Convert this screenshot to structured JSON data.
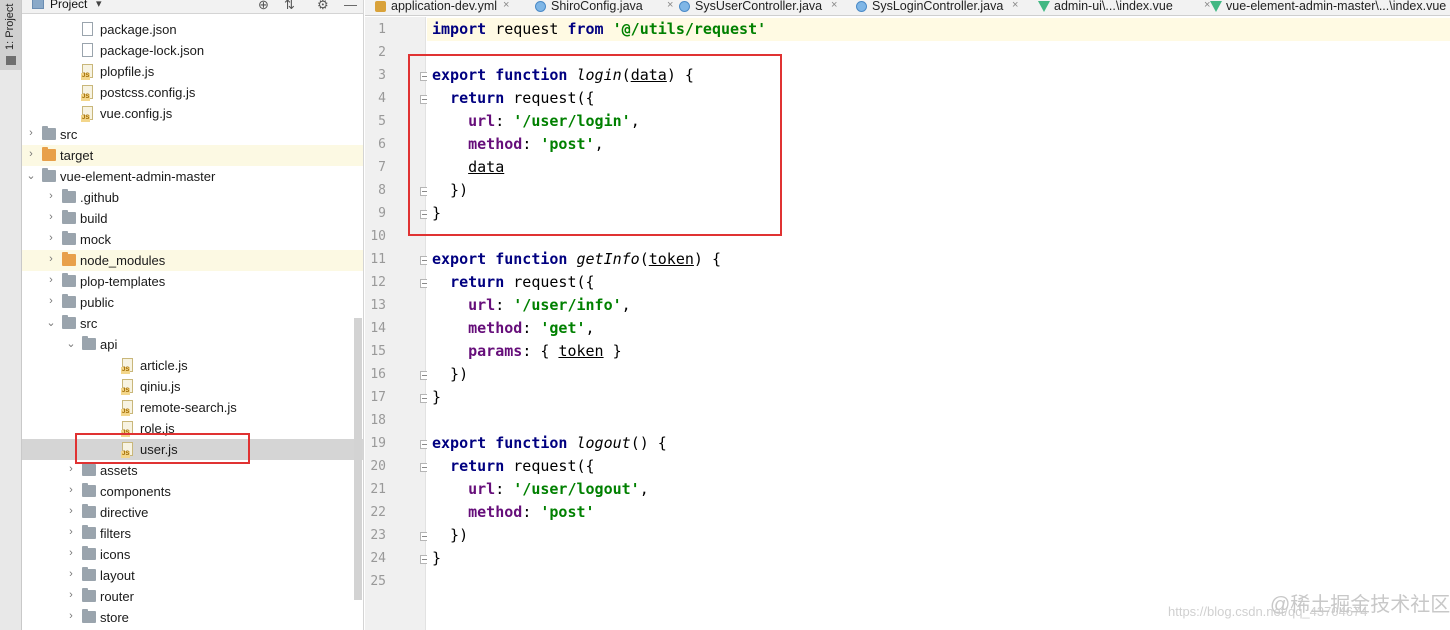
{
  "tool_strip": {
    "label": "1: Project"
  },
  "project_panel": {
    "title": "Project",
    "title_caret": "▾",
    "tools": [
      "⊕",
      "⇅",
      "⚙",
      "—"
    ],
    "tree": [
      {
        "label": "package.json",
        "type": "json",
        "depth": 3,
        "arrow": ""
      },
      {
        "label": "package-lock.json",
        "type": "json",
        "depth": 3,
        "arrow": ""
      },
      {
        "label": "plopfile.js",
        "type": "js",
        "depth": 3,
        "arrow": ""
      },
      {
        "label": "postcss.config.js",
        "type": "js",
        "depth": 3,
        "arrow": ""
      },
      {
        "label": "vue.config.js",
        "type": "js",
        "depth": 3,
        "arrow": ""
      },
      {
        "label": "src",
        "type": "folder",
        "depth": 1,
        "arrow": "›"
      },
      {
        "label": "target",
        "type": "folder-orange",
        "depth": 1,
        "arrow": "›",
        "highlight": "yellow"
      },
      {
        "label": "vue-element-admin-master",
        "type": "folder",
        "depth": 1,
        "arrow": "⌄"
      },
      {
        "label": ".github",
        "type": "folder",
        "depth": 2,
        "arrow": "›"
      },
      {
        "label": "build",
        "type": "folder",
        "depth": 2,
        "arrow": "›"
      },
      {
        "label": "mock",
        "type": "folder",
        "depth": 2,
        "arrow": "›"
      },
      {
        "label": "node_modules",
        "type": "folder-orange",
        "depth": 2,
        "arrow": "›",
        "highlight": "yellow"
      },
      {
        "label": "plop-templates",
        "type": "folder",
        "depth": 2,
        "arrow": "›"
      },
      {
        "label": "public",
        "type": "folder",
        "depth": 2,
        "arrow": "›"
      },
      {
        "label": "src",
        "type": "folder",
        "depth": 2,
        "arrow": "⌄"
      },
      {
        "label": "api",
        "type": "folder",
        "depth": 3,
        "arrow": "⌄"
      },
      {
        "label": "article.js",
        "type": "js",
        "depth": 5,
        "arrow": ""
      },
      {
        "label": "qiniu.js",
        "type": "js",
        "depth": 5,
        "arrow": ""
      },
      {
        "label": "remote-search.js",
        "type": "js",
        "depth": 5,
        "arrow": ""
      },
      {
        "label": "role.js",
        "type": "js",
        "depth": 5,
        "arrow": ""
      },
      {
        "label": "user.js",
        "type": "js",
        "depth": 5,
        "arrow": "",
        "selected": true
      },
      {
        "label": "assets",
        "type": "folder",
        "depth": 3,
        "arrow": "›"
      },
      {
        "label": "components",
        "type": "folder",
        "depth": 3,
        "arrow": "›"
      },
      {
        "label": "directive",
        "type": "folder",
        "depth": 3,
        "arrow": "›"
      },
      {
        "label": "filters",
        "type": "folder",
        "depth": 3,
        "arrow": "›"
      },
      {
        "label": "icons",
        "type": "folder",
        "depth": 3,
        "arrow": "›"
      },
      {
        "label": "layout",
        "type": "folder",
        "depth": 3,
        "arrow": "›"
      },
      {
        "label": "router",
        "type": "folder",
        "depth": 3,
        "arrow": "›"
      },
      {
        "label": "store",
        "type": "folder",
        "depth": 3,
        "arrow": "›"
      }
    ]
  },
  "tabs": [
    {
      "label": "application-dev.yml",
      "icon": "yml",
      "close": "×"
    },
    {
      "label": "ShiroConfig.java",
      "icon": "java",
      "close": "×"
    },
    {
      "label": "SysUserController.java",
      "icon": "java",
      "close": "×"
    },
    {
      "label": "SysLoginController.java",
      "icon": "java",
      "close": "×"
    },
    {
      "label": "admin-ui\\...\\index.vue",
      "icon": "vue",
      "close": "×"
    },
    {
      "label": "vue-element-admin-master\\...\\index.vue",
      "icon": "vue",
      "close": ""
    }
  ],
  "editor": {
    "highlighted_line": 1,
    "lines": [
      {
        "n": "1",
        "tokens": [
          [
            "kw",
            "import"
          ],
          [
            "plain",
            " request "
          ],
          [
            "kw",
            "from"
          ],
          [
            "plain",
            " "
          ],
          [
            "str",
            "'@/utils/request'"
          ]
        ]
      },
      {
        "n": "2",
        "tokens": []
      },
      {
        "n": "3",
        "fold": true,
        "tokens": [
          [
            "kw",
            "export function"
          ],
          [
            "plain",
            " "
          ],
          [
            "fn",
            "login"
          ],
          [
            "plain",
            "("
          ],
          [
            "param",
            "data"
          ],
          [
            "plain",
            ") {"
          ]
        ]
      },
      {
        "n": "4",
        "fold": true,
        "tokens": [
          [
            "plain",
            "  "
          ],
          [
            "kw",
            "return"
          ],
          [
            "plain",
            " request({"
          ]
        ]
      },
      {
        "n": "5",
        "tokens": [
          [
            "plain",
            "    "
          ],
          [
            "prop",
            "url"
          ],
          [
            "plain",
            ": "
          ],
          [
            "str",
            "'/user/login'"
          ],
          [
            "plain",
            ","
          ]
        ]
      },
      {
        "n": "6",
        "tokens": [
          [
            "plain",
            "    "
          ],
          [
            "prop",
            "method"
          ],
          [
            "plain",
            ": "
          ],
          [
            "str",
            "'post'"
          ],
          [
            "plain",
            ","
          ]
        ]
      },
      {
        "n": "7",
        "tokens": [
          [
            "plain",
            "    "
          ],
          [
            "param",
            "data"
          ]
        ]
      },
      {
        "n": "8",
        "fold": true,
        "tokens": [
          [
            "plain",
            "  })"
          ]
        ]
      },
      {
        "n": "9",
        "fold": true,
        "tokens": [
          [
            "plain",
            "}"
          ]
        ]
      },
      {
        "n": "10",
        "tokens": []
      },
      {
        "n": "11",
        "fold": true,
        "tokens": [
          [
            "kw",
            "export function"
          ],
          [
            "plain",
            " "
          ],
          [
            "fn",
            "getInfo"
          ],
          [
            "plain",
            "("
          ],
          [
            "param",
            "token"
          ],
          [
            "plain",
            ") {"
          ]
        ]
      },
      {
        "n": "12",
        "fold": true,
        "tokens": [
          [
            "plain",
            "  "
          ],
          [
            "kw",
            "return"
          ],
          [
            "plain",
            " request({"
          ]
        ]
      },
      {
        "n": "13",
        "tokens": [
          [
            "plain",
            "    "
          ],
          [
            "prop",
            "url"
          ],
          [
            "plain",
            ": "
          ],
          [
            "str",
            "'/user/info'"
          ],
          [
            "plain",
            ","
          ]
        ]
      },
      {
        "n": "14",
        "tokens": [
          [
            "plain",
            "    "
          ],
          [
            "prop",
            "method"
          ],
          [
            "plain",
            ": "
          ],
          [
            "str",
            "'get'"
          ],
          [
            "plain",
            ","
          ]
        ]
      },
      {
        "n": "15",
        "tokens": [
          [
            "plain",
            "    "
          ],
          [
            "prop",
            "params"
          ],
          [
            "plain",
            ": { "
          ],
          [
            "param",
            "token"
          ],
          [
            "plain",
            " }"
          ]
        ]
      },
      {
        "n": "16",
        "fold": true,
        "tokens": [
          [
            "plain",
            "  })"
          ]
        ]
      },
      {
        "n": "17",
        "fold": true,
        "tokens": [
          [
            "plain",
            "}"
          ]
        ]
      },
      {
        "n": "18",
        "tokens": []
      },
      {
        "n": "19",
        "fold": true,
        "tokens": [
          [
            "kw",
            "export function"
          ],
          [
            "plain",
            " "
          ],
          [
            "fn",
            "logout"
          ],
          [
            "plain",
            "() {"
          ]
        ]
      },
      {
        "n": "20",
        "fold": true,
        "tokens": [
          [
            "plain",
            "  "
          ],
          [
            "kw",
            "return"
          ],
          [
            "plain",
            " request({"
          ]
        ]
      },
      {
        "n": "21",
        "tokens": [
          [
            "plain",
            "    "
          ],
          [
            "prop",
            "url"
          ],
          [
            "plain",
            ": "
          ],
          [
            "str",
            "'/user/logout'"
          ],
          [
            "plain",
            ","
          ]
        ]
      },
      {
        "n": "22",
        "tokens": [
          [
            "plain",
            "    "
          ],
          [
            "prop",
            "method"
          ],
          [
            "plain",
            ": "
          ],
          [
            "str",
            "'post'"
          ]
        ]
      },
      {
        "n": "23",
        "fold": true,
        "tokens": [
          [
            "plain",
            "  })"
          ]
        ]
      },
      {
        "n": "24",
        "fold": true,
        "tokens": [
          [
            "plain",
            "}"
          ]
        ]
      },
      {
        "n": "25",
        "tokens": []
      }
    ]
  },
  "watermark": {
    "logo": "@稀土掘金技术社区",
    "url": "https://blog.csdn.net/qq_43704674"
  },
  "colors": {
    "annotation_red": "#e03232",
    "keyword": "#000080",
    "string": "#008000",
    "property": "#660e7a"
  }
}
